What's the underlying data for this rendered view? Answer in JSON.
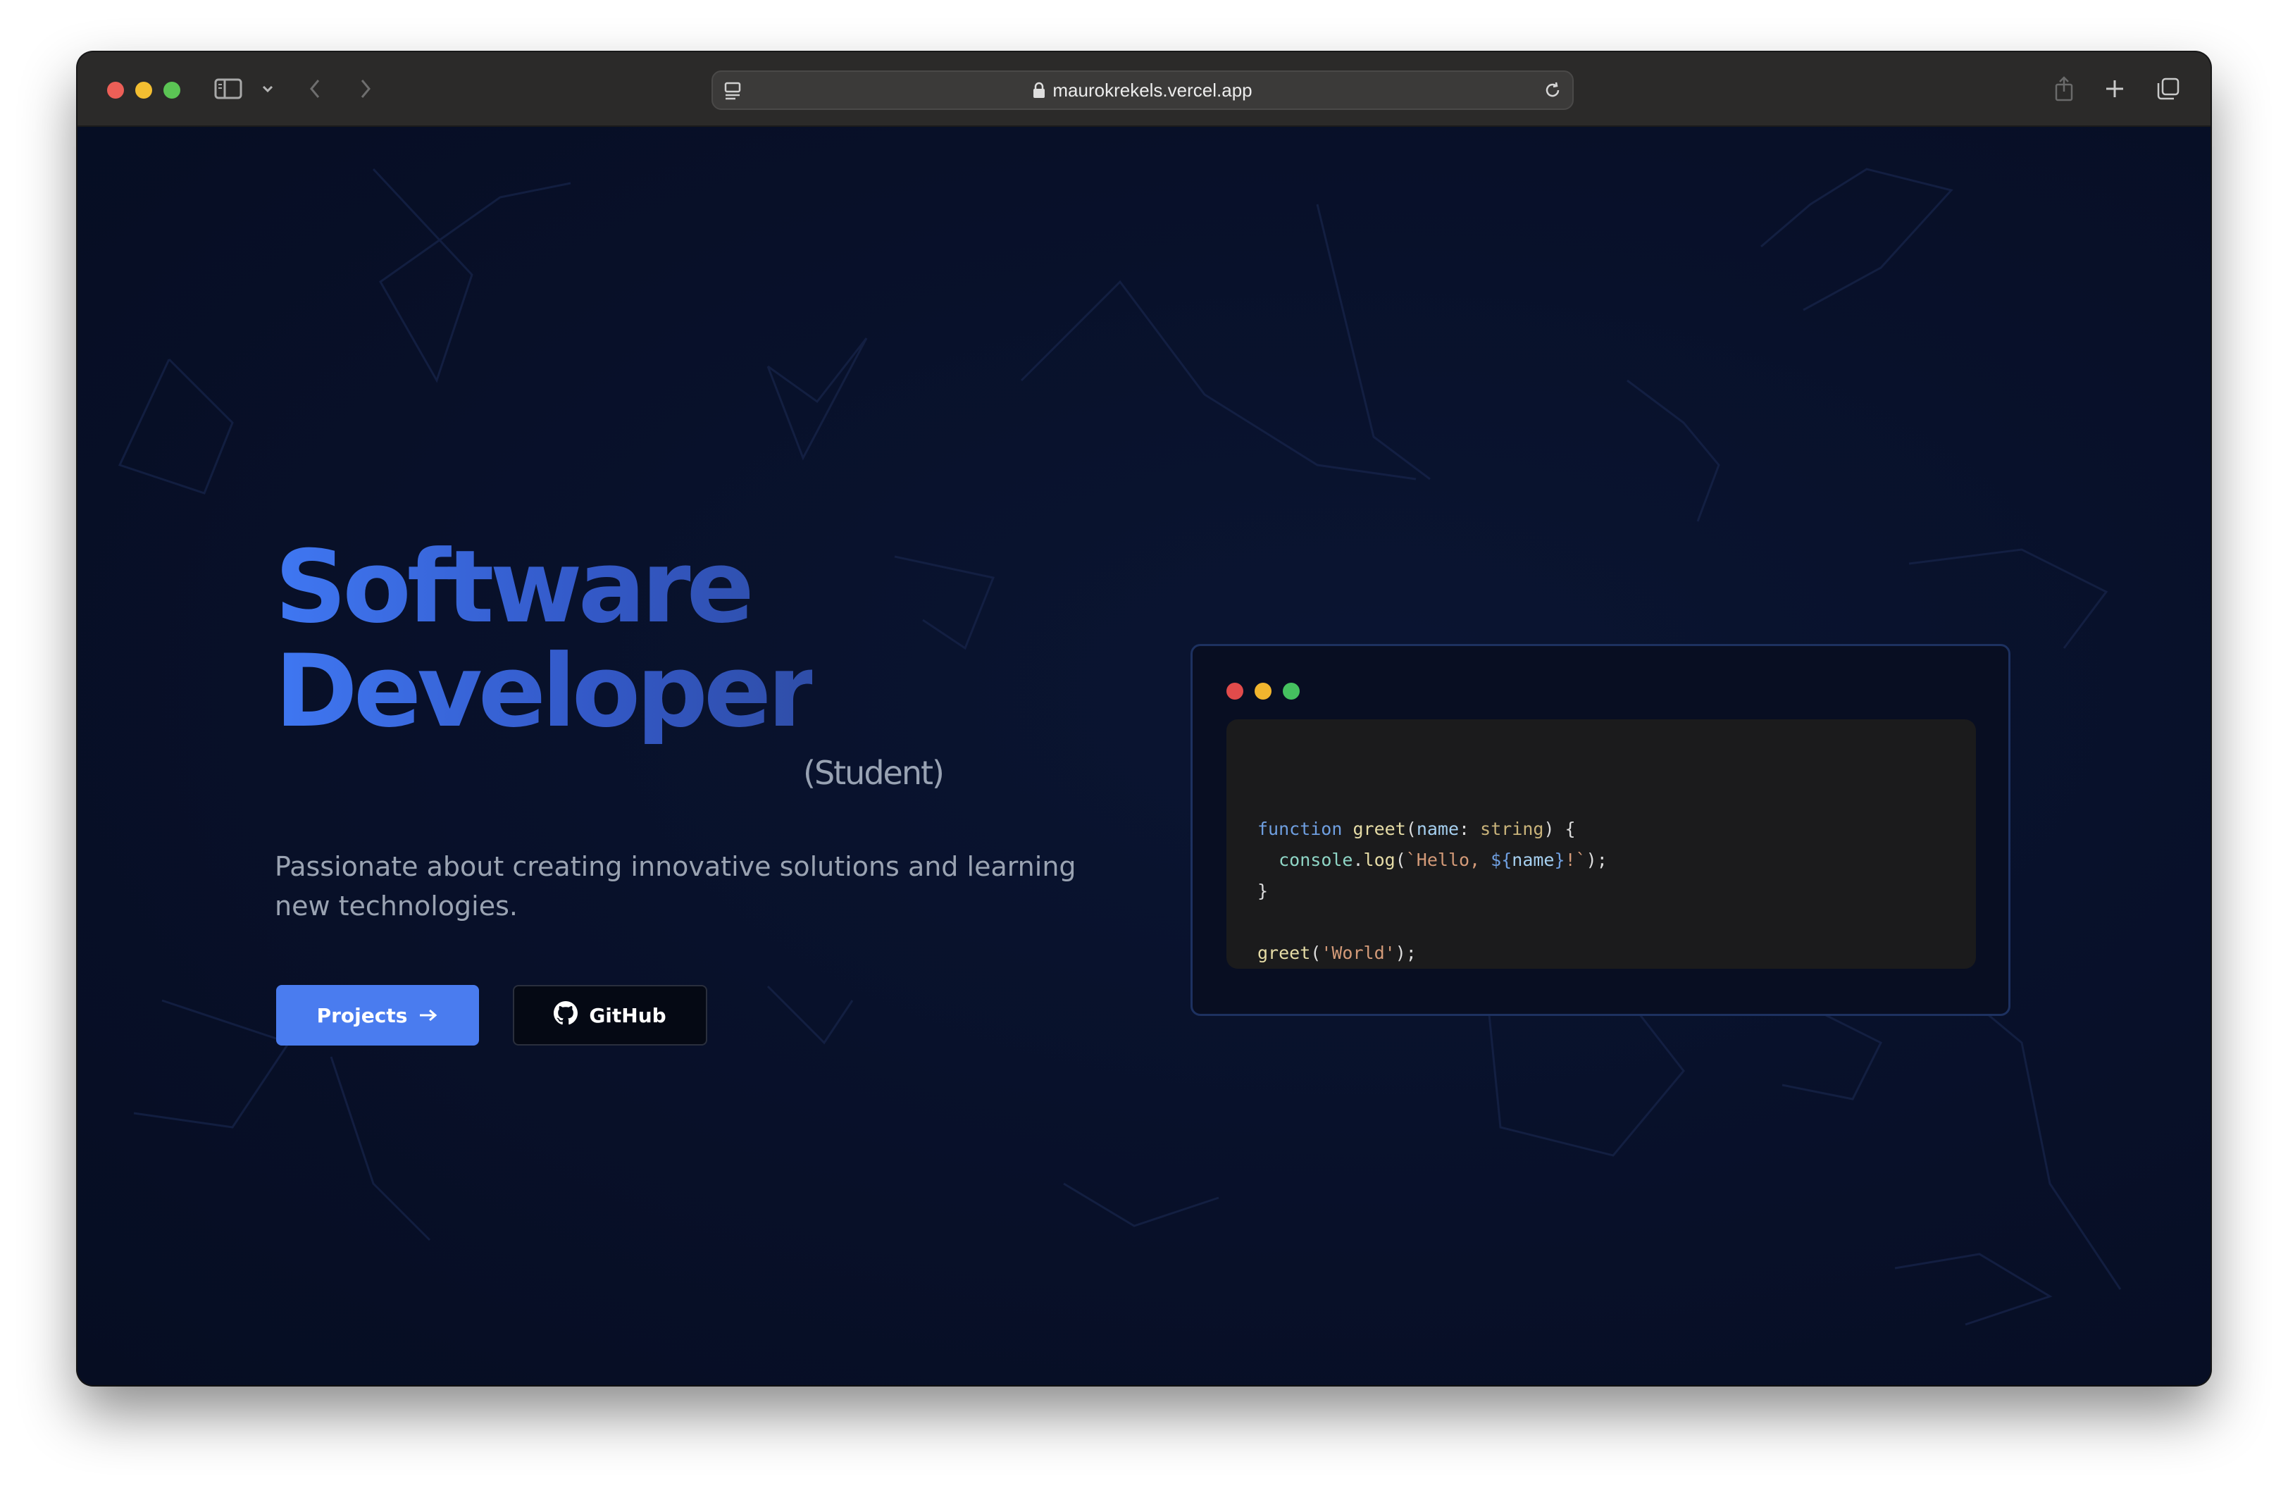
{
  "browser": {
    "url": "maurokrekels.vercel.app"
  },
  "hero": {
    "title_line1": "Software",
    "title_line2": "Developer",
    "tag": "(Student)",
    "subtitle": "Passionate about creating innovative solutions and learning new technologies.",
    "projects_label": "Projects",
    "github_label": "GitHub"
  },
  "code": {
    "line1": {
      "kw": "function",
      "fn": "greet",
      "open": "(",
      "param": "name",
      "colon": ": ",
      "type": "string",
      "close": ") {"
    },
    "line2": {
      "indent": "  ",
      "obj": "console",
      "dot": ".",
      "method": "log",
      "open": "(",
      "str1": "`Hello, ",
      "tpl_open": "${",
      "var": "name",
      "tpl_close": "}",
      "str2": "!`",
      "close": ");"
    },
    "line3": "}",
    "line5": {
      "fn": "greet",
      "open": "(",
      "arg": "'World'",
      "close": ");"
    }
  },
  "colors": {
    "accent": "#4a7cef",
    "background": "#081029",
    "title_gradient_start": "#3f77f2",
    "title_gradient_end": "#2f4ea8"
  }
}
